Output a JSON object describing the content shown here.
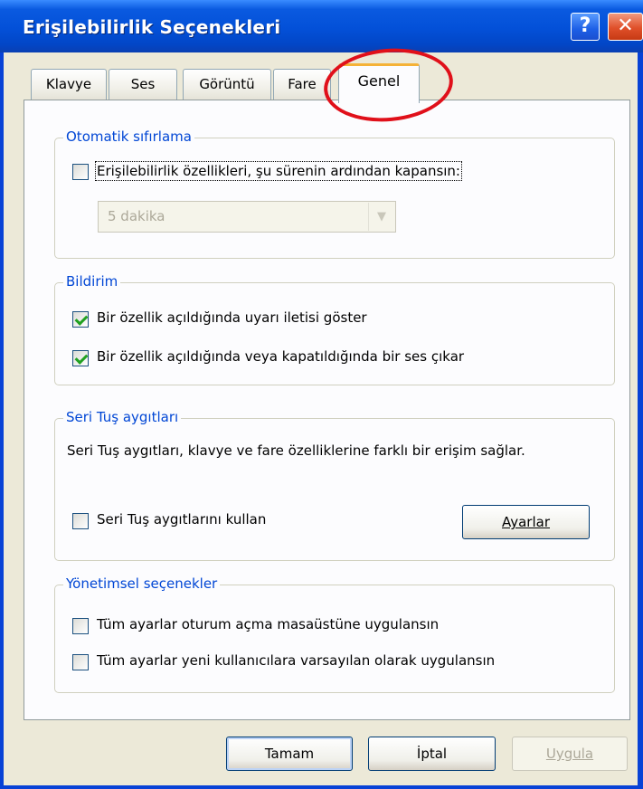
{
  "window": {
    "title": "Erişilebilirlik Seçenekleri",
    "help_label": "?",
    "close_label": "✕"
  },
  "tabs": [
    {
      "label": "Klavye",
      "active": false
    },
    {
      "label": "Ses",
      "active": false
    },
    {
      "label": "Görüntü",
      "active": false
    },
    {
      "label": "Fare",
      "active": false
    },
    {
      "label": "Genel",
      "active": true
    }
  ],
  "auto_reset": {
    "title": "Otomatik sıfırlama",
    "checkbox_label": "Erişilebilirlik özellikleri, şu sürenin ardından kapansın:",
    "checked": false,
    "dropdown_value": "5 dakika"
  },
  "notification": {
    "title": "Bildirim",
    "items": [
      {
        "label": "Bir özellik açıldığında uyarı iletisi göster",
        "checked": true
      },
      {
        "label": "Bir özellik açıldığında veya kapatıldığında bir ses çıkar",
        "checked": true
      }
    ]
  },
  "serial_keys": {
    "title": "Seri Tuş aygıtları",
    "description": "Seri Tuş aygıtları, klavye ve fare özelliklerine farklı bir erişim sağlar.",
    "checkbox_label": "Seri Tuş aygıtlarını kullan",
    "checked": false,
    "settings_button": "Ayarlar"
  },
  "admin": {
    "title": "Yönetimsel seçenekler",
    "items": [
      {
        "label": "Tüm ayarlar oturum açma masaüstüne uygulansın",
        "checked": false
      },
      {
        "label": "Tüm ayarlar yeni kullanıcılara varsayılan olarak uygulansın",
        "checked": false
      }
    ]
  },
  "footer": {
    "ok": "Tamam",
    "cancel": "İptal",
    "apply": "Uygula"
  },
  "colors": {
    "titlebar": "#0a5ae0",
    "group_title": "#0046d5",
    "highlight": "#e0101a",
    "face": "#ece9d8"
  }
}
